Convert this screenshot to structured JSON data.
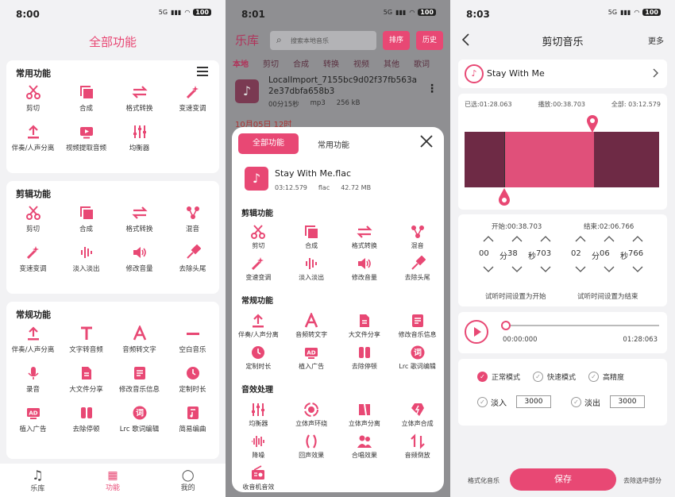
{
  "status": {
    "time1": "8:00",
    "time2": "8:01",
    "time3": "8:03",
    "battery": "100",
    "signal": "5G"
  },
  "p1": {
    "title": "全部功能",
    "common": {
      "title": "常用功能",
      "items": [
        "剪切",
        "合成",
        "格式转换",
        "变速变调",
        "伴奏/人声分离",
        "视频提取音频",
        "均衡器"
      ]
    },
    "edit": {
      "title": "剪辑功能",
      "items": [
        "剪切",
        "合成",
        "格式转换",
        "混音",
        "变速变调",
        "淡入淡出",
        "修改音量",
        "去除头尾"
      ]
    },
    "regular": {
      "title": "常规功能",
      "items": [
        "伴奏/人声分离",
        "文字转音频",
        "音频转文字",
        "空白音乐",
        "录音",
        "大文件分享",
        "修改音乐信息",
        "定制时长",
        "植入广告",
        "去除停顿",
        "Lrc 歌词编辑",
        "简易编曲"
      ]
    },
    "tabs": [
      "乐库",
      "功能",
      "我的"
    ]
  },
  "p2": {
    "title": "乐库",
    "search_placeholder": "搜索本地音乐",
    "sort": "排序",
    "history": "历史",
    "subtabs": [
      "本地",
      "剪切",
      "合成",
      "转换",
      "视频",
      "其他",
      "歌词"
    ],
    "file": {
      "name": "LocalImport_7155bc9d02f37fb563a2e37dbfa658b3",
      "duration": "00分15秒",
      "format": "mp3",
      "size": "256 kB"
    },
    "date": "10月05日 12时",
    "sheet": {
      "tab_all": "全部功能",
      "tab_common": "常用功能",
      "song": {
        "name": "Stay With Me.flac",
        "duration": "03:12.579",
        "format": "flac",
        "size": "42.72 MB"
      },
      "edit": {
        "title": "剪辑功能",
        "items": [
          "剪切",
          "合成",
          "格式转换",
          "混音",
          "变速变调",
          "淡入淡出",
          "修改音量",
          "去除头尾"
        ]
      },
      "regular": {
        "title": "常规功能",
        "items": [
          "伴奏/人声分离",
          "音频转文字",
          "大文件分享",
          "修改音乐信息",
          "定制时长",
          "植入广告",
          "去除停顿",
          "Lrc 歌词编辑"
        ]
      },
      "effects": {
        "title": "音效处理",
        "items": [
          "均衡器",
          "立体声环绕",
          "立体声分离",
          "立体声合成",
          "降噪",
          "回声效果",
          "合唱效果",
          "音频倒放",
          "收音机音效"
        ]
      }
    }
  },
  "p3": {
    "title": "剪切音乐",
    "more": "更多",
    "song": "Stay With Me",
    "selected": "已选:01:28.063",
    "playing": "播放:00:38.703",
    "total": "全部: 03:12.579",
    "start_label": "开始:00:38.703",
    "end_label": "结束:02:06.766",
    "start": {
      "min": "00",
      "min_u": "分",
      "sec": "38",
      "sec_u": "秒",
      "ms": "703"
    },
    "end": {
      "min": "02",
      "min_u": "分",
      "sec": "06",
      "sec_u": "秒",
      "ms": "766"
    },
    "set_start": "试听时间设置为开始",
    "set_end": "试听时间设置为结束",
    "play_current": "00:00:000",
    "play_total": "01:28:063",
    "modes": [
      "正常模式",
      "快速模式",
      "高精度"
    ],
    "fade_in": "淡入",
    "fade_in_val": "3000",
    "fade_out": "淡出",
    "fade_out_val": "3000",
    "format_music": "格式化音乐",
    "save": "保存",
    "remove_selected": "去除选中部分"
  },
  "colors": {
    "accent": "#e84874",
    "wave_dark": "#6e2a45",
    "wave_sel": "#e0507a"
  }
}
